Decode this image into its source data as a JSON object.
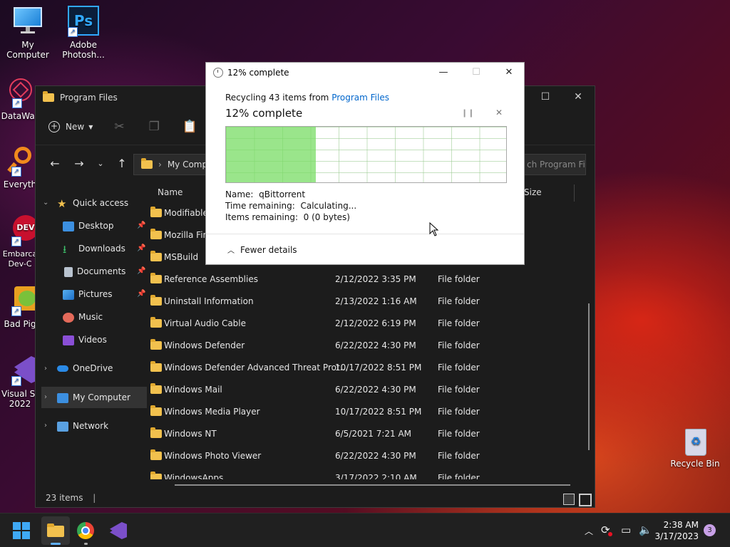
{
  "desktop": {
    "icons": [
      {
        "label": "My Computer"
      },
      {
        "label": "Adobe Photosh..."
      },
      {
        "label": "DataWag"
      },
      {
        "label": "Everyth"
      },
      {
        "label": "Embarca Dev-C"
      },
      {
        "label": "Bad Pig"
      },
      {
        "label": "Visual St 2022"
      },
      {
        "label": "Recycle Bin"
      }
    ]
  },
  "explorer": {
    "title": "Program Files",
    "toolbar": {
      "new_label": "New"
    },
    "address": {
      "crumb": "My Compu"
    },
    "search": {
      "placeholder": "ch Program Fi..."
    },
    "nav": {
      "quick_access": "Quick access",
      "desktop": "Desktop",
      "downloads": "Downloads",
      "documents": "Documents",
      "pictures": "Pictures",
      "music": "Music",
      "videos": "Videos",
      "onedrive": "OneDrive",
      "my_computer": "My Computer",
      "network": "Network"
    },
    "columns": {
      "name": "Name",
      "size": "Size"
    },
    "rows": [
      {
        "name": "ModifiableW",
        "date": "",
        "type": ""
      },
      {
        "name": "Mozilla Fire",
        "date": "",
        "type": ""
      },
      {
        "name": "MSBuild",
        "date": "",
        "type": ""
      },
      {
        "name": "Reference Assemblies",
        "date": "2/12/2022 3:35 PM",
        "type": "File folder"
      },
      {
        "name": "Uninstall Information",
        "date": "2/13/2022 1:16 AM",
        "type": "File folder"
      },
      {
        "name": "Virtual Audio Cable",
        "date": "2/12/2022 6:19 PM",
        "type": "File folder"
      },
      {
        "name": "Windows Defender",
        "date": "6/22/2022 4:30 PM",
        "type": "File folder"
      },
      {
        "name": "Windows Defender Advanced Threat Prot...",
        "date": "10/17/2022 8:51 PM",
        "type": "File folder"
      },
      {
        "name": "Windows Mail",
        "date": "6/22/2022 4:30 PM",
        "type": "File folder"
      },
      {
        "name": "Windows Media Player",
        "date": "10/17/2022 8:51 PM",
        "type": "File folder"
      },
      {
        "name": "Windows NT",
        "date": "6/5/2021 7:21 AM",
        "type": "File folder"
      },
      {
        "name": "Windows Photo Viewer",
        "date": "6/22/2022 4:30 PM",
        "type": "File folder"
      },
      {
        "name": "WindowsApps",
        "date": "3/17/2022 2:10 AM",
        "type": "File folder"
      }
    ],
    "status": "23 items"
  },
  "dialog": {
    "title": "12% complete",
    "recycling_prefix": "Recycling 43 items from ",
    "source_link": "Program Files",
    "heading": "12% complete",
    "progress_fraction": 0.32,
    "name_label": "Name:",
    "name_value": "qBittorrent",
    "time_label": "Time remaining:",
    "time_value": "Calculating...",
    "items_label": "Items remaining:",
    "items_value": "0 (0 bytes)",
    "fewer_details": "Fewer details"
  },
  "taskbar": {
    "time": "2:38 AM",
    "date": "3/17/2023",
    "badge": "3"
  },
  "colors": {
    "accent": "#0078d4",
    "progress_fill": "#78dc64",
    "folder": "#f2c14e"
  }
}
